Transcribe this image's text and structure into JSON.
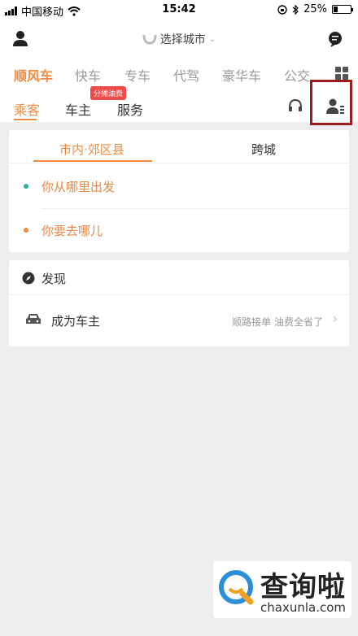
{
  "status": {
    "carrier": "中国移动",
    "time": "15:42",
    "battery": "25%",
    "battery_level": 0.25
  },
  "header": {
    "city_placeholder": "选择城市",
    "chevron": "⌄"
  },
  "top_tabs": [
    {
      "label": "顺风车",
      "active": true
    },
    {
      "label": "快车"
    },
    {
      "label": "专车"
    },
    {
      "label": "代驾"
    },
    {
      "label": "豪华车"
    },
    {
      "label": "公交"
    }
  ],
  "sub_tabs": [
    {
      "label": "乘客",
      "active": true
    },
    {
      "label": "车主"
    },
    {
      "label": "服务"
    }
  ],
  "promo_badge": "分摊油费",
  "ride": {
    "tabs": [
      {
        "label": "市内·郊区县",
        "active": true
      },
      {
        "label": "跨城"
      }
    ],
    "from_placeholder": "你从哪里出发",
    "to_placeholder": "你要去哪儿"
  },
  "discover": {
    "title": "发现",
    "become_driver": "成为车主",
    "become_driver_sub": "顺路接单 油费全省了",
    "chevron": "›"
  },
  "watermark": {
    "brand": "查询啦",
    "url": "chaxunla.com"
  },
  "colors": {
    "accent": "#f08a3e",
    "from_dot": "#2bb3a0",
    "to_dot": "#f08a3e",
    "badge": "#ee4b4b",
    "highlight_box": "#9b1c1c"
  }
}
